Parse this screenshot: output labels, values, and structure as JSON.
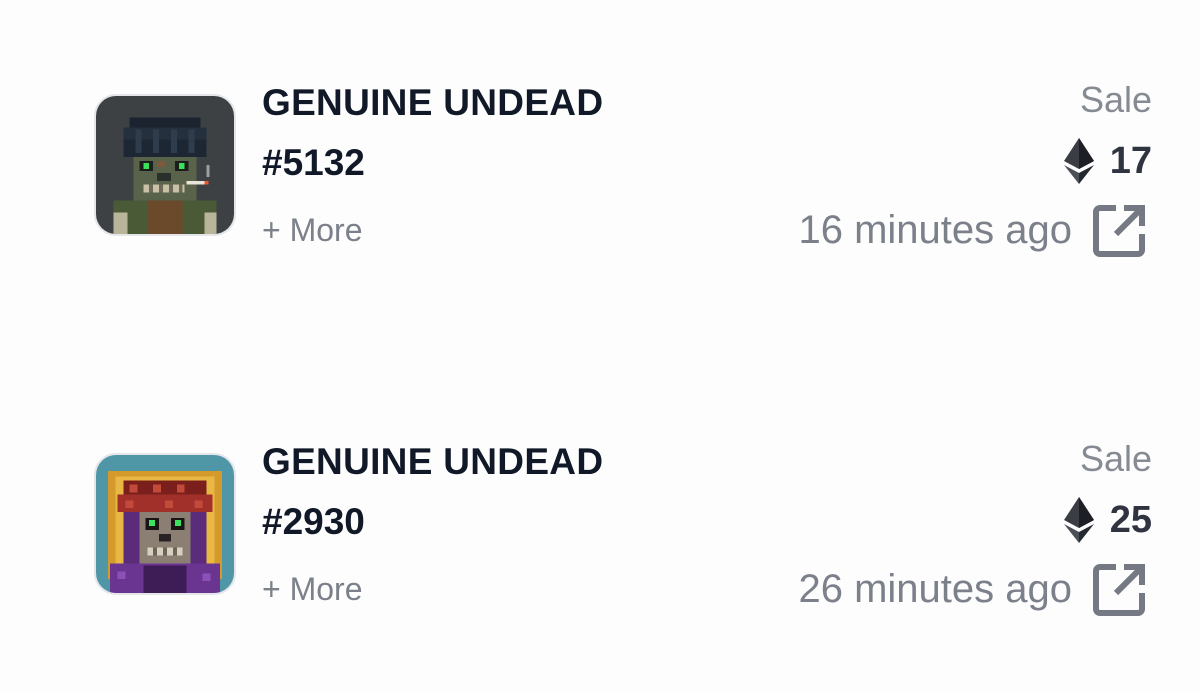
{
  "activity": [
    {
      "collection": "GENUINE UNDEAD",
      "token": "#5132",
      "more_label": "+ More",
      "event": "Sale",
      "price": "17",
      "currency_icon": "ethereum-icon",
      "time": "16 minutes ago",
      "link_icon": "external-link-icon",
      "thumb_bg": "#3d4143"
    },
    {
      "collection": "GENUINE UNDEAD",
      "token": "#2930",
      "more_label": "+ More",
      "event": "Sale",
      "price": "25",
      "currency_icon": "ethereum-icon",
      "time": "26 minutes ago",
      "link_icon": "external-link-icon",
      "thumb_bg": "#4f96a7"
    }
  ]
}
